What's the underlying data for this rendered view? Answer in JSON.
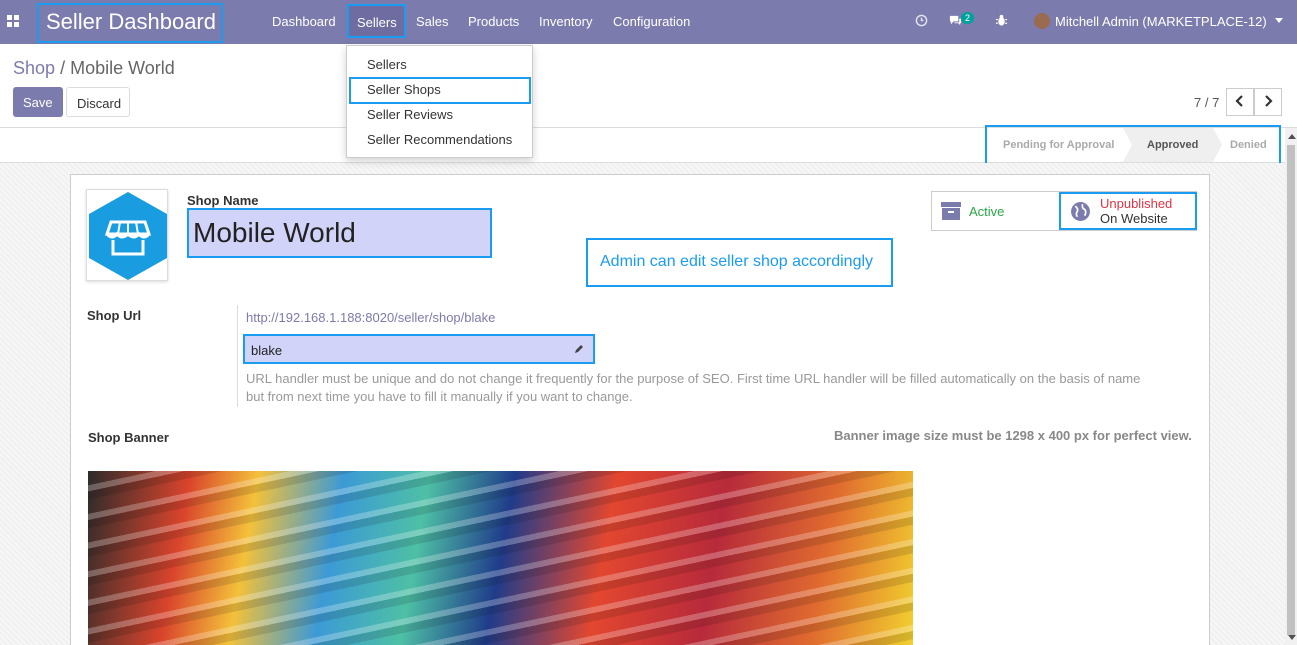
{
  "navbar": {
    "brand": "Seller Dashboard",
    "menu": [
      "Dashboard",
      "Sellers",
      "Sales",
      "Products",
      "Inventory",
      "Configuration"
    ],
    "chat_badge": "2",
    "user": "Mitchell Admin (MARKETPLACE-12)"
  },
  "dropdown": {
    "items": [
      "Sellers",
      "Seller Shops",
      "Seller Reviews",
      "Seller Recommendations"
    ]
  },
  "breadcrumb": {
    "parent": "Shop",
    "separator": "/",
    "current": "Mobile World"
  },
  "buttons": {
    "save": "Save",
    "discard": "Discard"
  },
  "pager": {
    "value": "7 / 7"
  },
  "status": {
    "stages": [
      "Pending for Approval",
      "Approved",
      "Denied"
    ],
    "active": "Approved"
  },
  "form": {
    "shop_name_label": "Shop Name",
    "shop_name": "Mobile World",
    "annotation": "Admin can edit seller shop accordingly",
    "active_label": "Active",
    "web_status_line1": "Unpublished",
    "web_status_line2": "On Website",
    "shop_url_label": "Shop Url",
    "shop_url": "http://192.168.1.188:8020/seller/shop/blake",
    "url_handler": "blake",
    "help_text": "URL handler must be unique and do not change it frequently for the purpose of SEO. First time URL handler will be filled automatically on the basis of name but from next time you have to fill it manually if you want to change.",
    "banner_label": "Shop Banner",
    "banner_note": "Banner image size must be 1298 x 400 px for perfect view."
  },
  "colors": {
    "navbar": "#7c7bad",
    "highlight": "#1a9cf0",
    "field_bg": "#d1d3f8",
    "active_green": "#28a745",
    "unpublished_red": "#dc3545"
  },
  "icons": [
    "apps-icon",
    "clock-icon",
    "chat-icon",
    "bug-icon",
    "shop-icon",
    "archive-icon",
    "globe-icon",
    "pencil-icon",
    "chevron-left-icon",
    "chevron-right-icon"
  ]
}
